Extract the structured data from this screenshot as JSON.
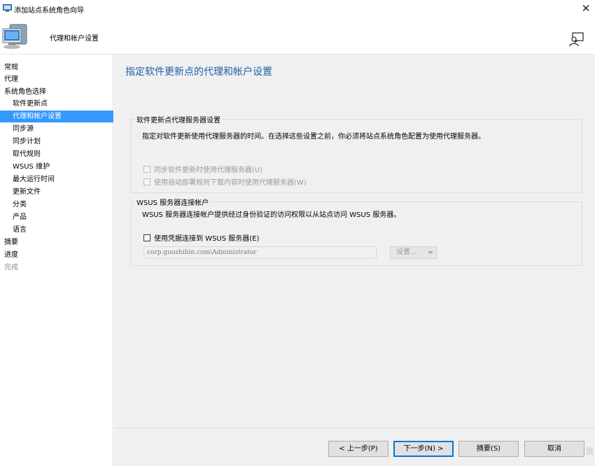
{
  "window": {
    "title": "添加站点系统角色向导",
    "close_glyph": "✕"
  },
  "header": {
    "title": "代理和帐户设置",
    "icon": "computer-icon",
    "help_icon": "help-person-icon"
  },
  "sidebar": {
    "items": [
      {
        "label": "常规"
      },
      {
        "label": "代理"
      },
      {
        "label": "系统角色选择"
      },
      {
        "label": "软件更新点"
      },
      {
        "label": "代理和帐户设置"
      },
      {
        "label": "同步源"
      },
      {
        "label": "同步计划"
      },
      {
        "label": "取代规则"
      },
      {
        "label": "WSUS 维护"
      },
      {
        "label": "最大运行时间"
      },
      {
        "label": "更新文件"
      },
      {
        "label": "分类"
      },
      {
        "label": "产品"
      },
      {
        "label": "语言"
      },
      {
        "label": "摘要"
      },
      {
        "label": "进度"
      },
      {
        "label": "完成"
      }
    ],
    "active_label": "代理和帐户设置",
    "disabled_label": "完成"
  },
  "main": {
    "page_title": "指定软件更新点的代理和帐户设置",
    "proxy_group": {
      "title": "软件更新点代理服务器设置",
      "description": "指定对软件更新使用代理服务器的时间。在选择这些设置之前，你必须将站点系统角色配置为使用代理服务器。",
      "checkbox_sync": "同步软件更新时使用代理服务器(U)",
      "checkbox_deploy": "使用自动部署规则下载内容时使用代理服务器(W)"
    },
    "account_group": {
      "title": "WSUS 服务器连接帐户",
      "description": "WSUS 服务器连接帐户提供经过身份验证的访问权限以从站点访问 WSUS 服务器。",
      "checkbox_credentials": "使用凭据连接到 WSUS 服务器(E)",
      "account_value": "corp.guozhibin.com\\Administrator",
      "set_button": "设置..."
    }
  },
  "footer": {
    "back": "< 上一步(P)",
    "next": "下一步(N) >",
    "summary": "摘要(S)",
    "cancel": "取消"
  },
  "watermark": "激"
}
